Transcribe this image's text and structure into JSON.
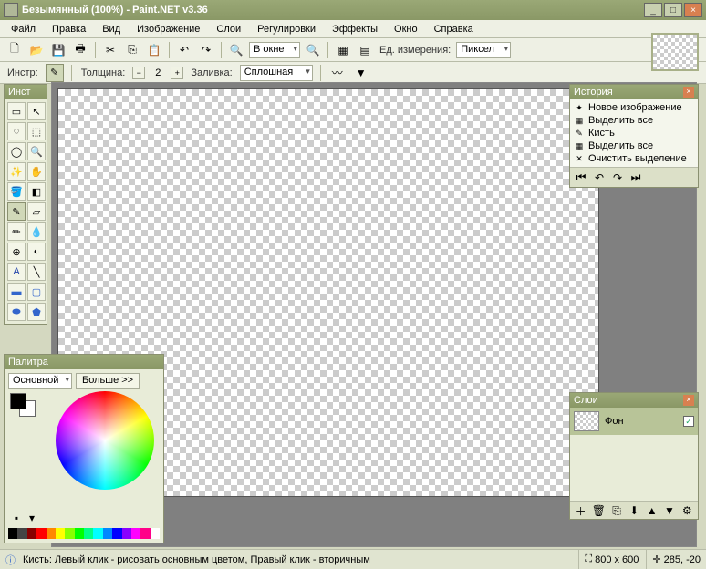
{
  "window": {
    "title": "Безымянный (100%) - Paint.NET v3.36"
  },
  "menu": {
    "items": [
      "Файл",
      "Правка",
      "Вид",
      "Изображение",
      "Слои",
      "Регулировки",
      "Эффекты",
      "Окно",
      "Справка"
    ]
  },
  "toolbar1": {
    "zoom_label": "В окне",
    "units_label": "Ед. измерения:",
    "units_value": "Пиксел"
  },
  "toolbar2": {
    "tool_label": "Инстр:",
    "width_label": "Толщина:",
    "width_value": "2",
    "fill_label": "Заливка:",
    "fill_value": "Сплошная"
  },
  "tools_panel": {
    "title": "Инст"
  },
  "history_panel": {
    "title": "История",
    "items": [
      {
        "icon": "✦",
        "label": "Новое изображение"
      },
      {
        "icon": "▦",
        "label": "Выделить все"
      },
      {
        "icon": "✎",
        "label": "Кисть"
      },
      {
        "icon": "▦",
        "label": "Выделить все"
      },
      {
        "icon": "✕",
        "label": "Очистить выделение"
      }
    ]
  },
  "layers_panel": {
    "title": "Слои",
    "layer_name": "Фон"
  },
  "palette_panel": {
    "title": "Палитра",
    "mode": "Основной",
    "more": "Больше >>",
    "colors": [
      "#000",
      "#444",
      "#800",
      "#f00",
      "#f80",
      "#ff0",
      "#8f0",
      "#0f0",
      "#0f8",
      "#0ff",
      "#08f",
      "#00f",
      "#80f",
      "#f0f",
      "#f08",
      "#fff"
    ]
  },
  "statusbar": {
    "hint": "Кисть: Левый клик - рисовать основным цветом, Правый клик - вторичным",
    "size": "800 x 600",
    "coords": "285, -20"
  }
}
